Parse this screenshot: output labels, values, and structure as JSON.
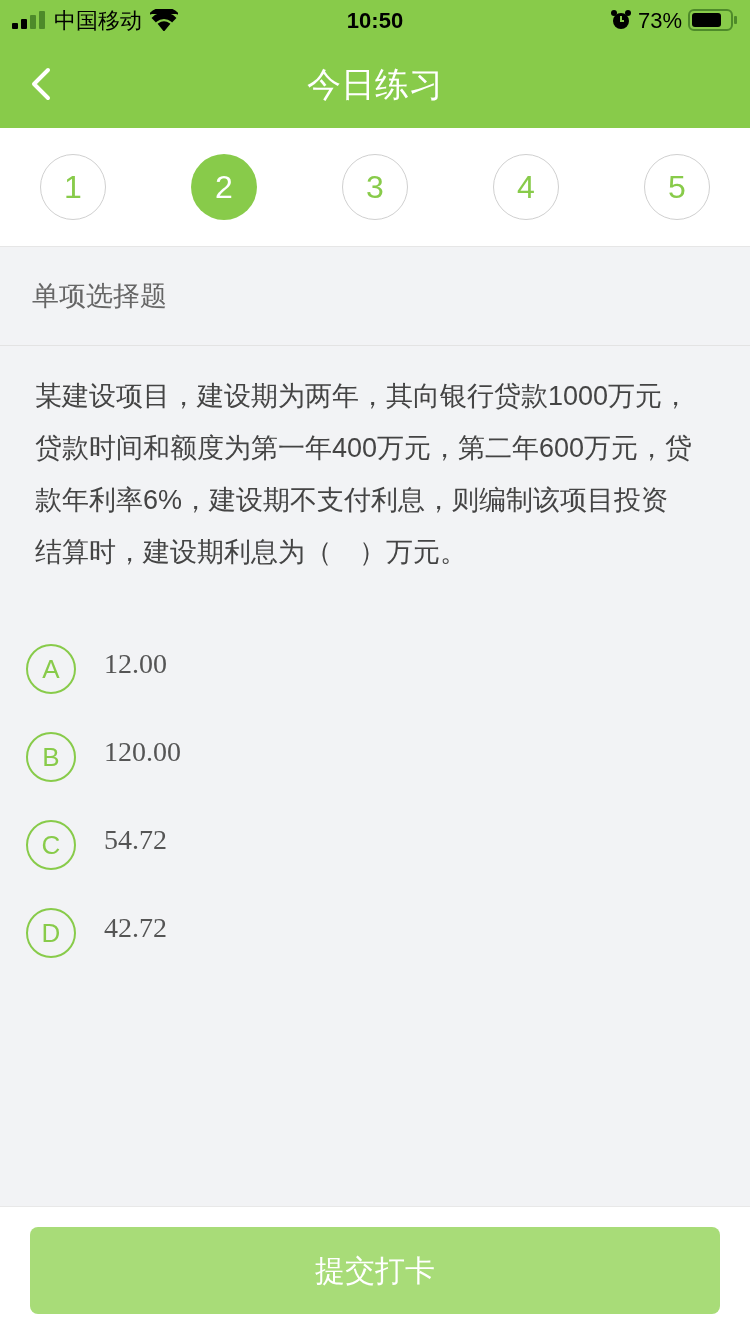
{
  "status_bar": {
    "carrier": "中国移动",
    "time": "10:50",
    "battery": "73%"
  },
  "nav": {
    "title": "今日练习"
  },
  "steps": [
    {
      "label": "1",
      "selected": false
    },
    {
      "label": "2",
      "selected": true
    },
    {
      "label": "3",
      "selected": false
    },
    {
      "label": "4",
      "selected": false
    },
    {
      "label": "5",
      "selected": false
    }
  ],
  "question_type": "单项选择题",
  "question": "某建设项目，建设期为两年，其向银行贷款1000万元，贷款时间和额度为第一年400万元，第二年600万元，贷款年利率6%，建设期不支付利息，则编制该项目投资结算时，建设期利息为（　）万元。",
  "options": [
    {
      "letter": "A",
      "text": "12.00",
      "selected": false
    },
    {
      "letter": "B",
      "text": "120.00",
      "selected": false
    },
    {
      "letter": "C",
      "text": "54.72",
      "selected": false
    },
    {
      "letter": "D",
      "text": "42.72",
      "selected": false
    }
  ],
  "submit": {
    "label": "提交打卡",
    "disabled": true
  }
}
